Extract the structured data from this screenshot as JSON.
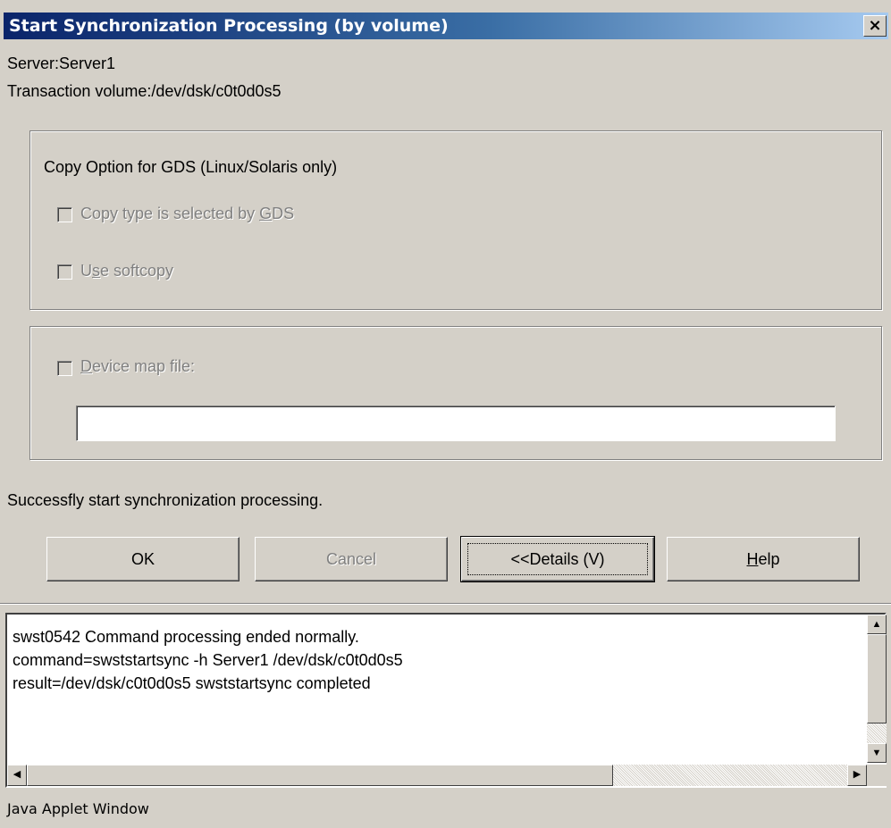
{
  "window": {
    "title": "Start Synchronization Processing (by volume)",
    "close_glyph": "×"
  },
  "info": {
    "server": "Server:Server1",
    "transaction_volume": "Transaction volume:/dev/dsk/c0t0d0s5"
  },
  "gds_group": {
    "label": "Copy Option for GDS (Linux/Solaris only)",
    "copy_type_pre": "Copy type is selected by ",
    "copy_type_mn": "G",
    "copy_type_post": "DS",
    "softcopy_pre": "U",
    "softcopy_mn": "s",
    "softcopy_post": "e softcopy",
    "copy_type_checked": false,
    "softcopy_checked": false
  },
  "device_map": {
    "label_mn": "D",
    "label_rest": "evice map file:",
    "checked": false,
    "value": ""
  },
  "status_message": "Successfly start synchronization processing.",
  "buttons": {
    "ok": "OK",
    "cancel": "Cancel",
    "details": "<<Details (V)",
    "help_mn": "H",
    "help_rest": "elp"
  },
  "log": {
    "lines": [
      "swst0542 Command processing ended normally.",
      "command=swststartsync -h Server1 /dev/dsk/c0t0d0s5",
      "result=/dev/dsk/c0t0d0s5 swststartsync completed"
    ]
  },
  "status_bar": "Java Applet Window"
}
